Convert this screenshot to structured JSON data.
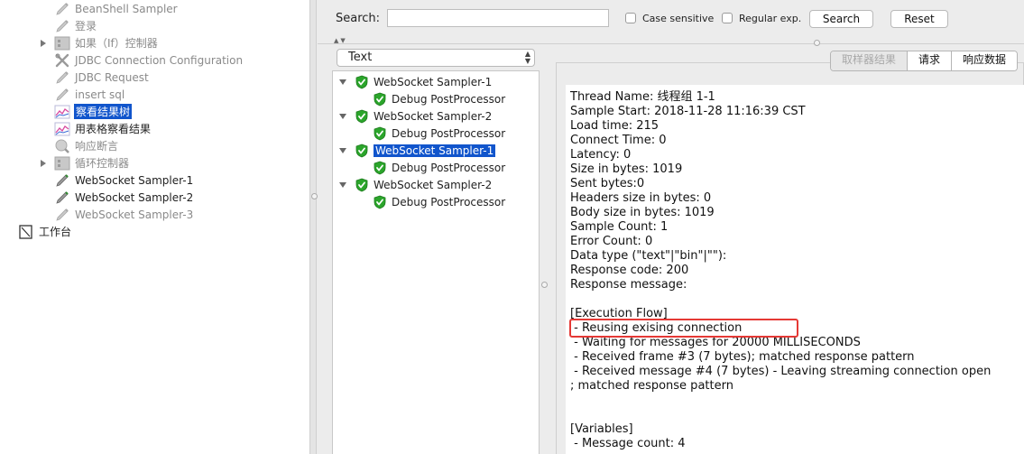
{
  "test_plan_tree": {
    "items": [
      {
        "label": "BeanShell Sampler",
        "icon": "pencil-icon",
        "disabled": true
      },
      {
        "label": "登录",
        "icon": "pencil-icon",
        "disabled": true
      },
      {
        "label": "如果（If）控制器",
        "icon": "controller-icon",
        "disabled": true,
        "expandable": true
      },
      {
        "label": "JDBC Connection Configuration",
        "icon": "wrench-icon",
        "disabled": true
      },
      {
        "label": "JDBC Request",
        "icon": "pencil-icon",
        "disabled": true
      },
      {
        "label": "insert sql",
        "icon": "pencil-icon",
        "disabled": true
      },
      {
        "label": "察看结果树",
        "icon": "chart-icon",
        "selected": true
      },
      {
        "label": "用表格察看结果",
        "icon": "chart-icon"
      },
      {
        "label": "响应断言",
        "icon": "magnifier-icon",
        "disabled": true
      },
      {
        "label": "循环控制器",
        "icon": "controller-icon",
        "disabled": true,
        "expandable": true
      },
      {
        "label": "WebSocket Sampler-1",
        "icon": "pencil-icon"
      },
      {
        "label": "WebSocket Sampler-2",
        "icon": "pencil-icon"
      },
      {
        "label": "WebSocket Sampler-3",
        "icon": "pencil-icon",
        "disabled": true
      }
    ],
    "workbench_label": "工作台"
  },
  "search": {
    "label": "Search:",
    "value": "",
    "case_sensitive_label": "Case sensitive",
    "case_sensitive_checked": false,
    "regex_label": "Regular exp.",
    "regex_checked": false,
    "search_button": "Search",
    "reset_button": "Reset"
  },
  "renderer": {
    "selected": "Text"
  },
  "results_tree": {
    "items": [
      {
        "label": "WebSocket Sampler-1",
        "level": 0,
        "status": "success"
      },
      {
        "label": "Debug PostProcessor",
        "level": 1,
        "status": "success"
      },
      {
        "label": "WebSocket Sampler-2",
        "level": 0,
        "status": "success"
      },
      {
        "label": "Debug PostProcessor",
        "level": 1,
        "status": "success"
      },
      {
        "label": "WebSocket Sampler-1",
        "level": 0,
        "status": "success",
        "selected": true
      },
      {
        "label": "Debug PostProcessor",
        "level": 1,
        "status": "success"
      },
      {
        "label": "WebSocket Sampler-2",
        "level": 0,
        "status": "success"
      },
      {
        "label": "Debug PostProcessor",
        "level": 1,
        "status": "success"
      }
    ]
  },
  "tabs": [
    {
      "label": "取样器结果",
      "active": true
    },
    {
      "label": "请求"
    },
    {
      "label": "响应数据"
    }
  ],
  "sampler_result": {
    "lines": [
      "Thread Name: 线程组 1-1",
      "Sample Start: 2018-11-28 11:16:39 CST",
      "Load time: 215",
      "Connect Time: 0",
      "Latency: 0",
      "Size in bytes: 1019",
      "Sent bytes:0",
      "Headers size in bytes: 0",
      "Body size in bytes: 1019",
      "Sample Count: 1",
      "Error Count: 0",
      "Data type (\"text\"|\"bin\"|\"\"): ",
      "Response code: 200",
      "Response message: ",
      "",
      "[Execution Flow]",
      " - Reusing exising connection",
      " - Waiting for messages for 20000 MILLISECONDS",
      " - Received frame #3 (7 bytes); matched response pattern",
      " - Received message #4 (7 bytes) - Leaving streaming connection open",
      "; matched response pattern",
      "",
      "",
      "[Variables]",
      " - Message count: 4"
    ],
    "highlight_color": "#e53935"
  },
  "colors": {
    "selection": "#1155cc",
    "success": "#2ba52b"
  }
}
